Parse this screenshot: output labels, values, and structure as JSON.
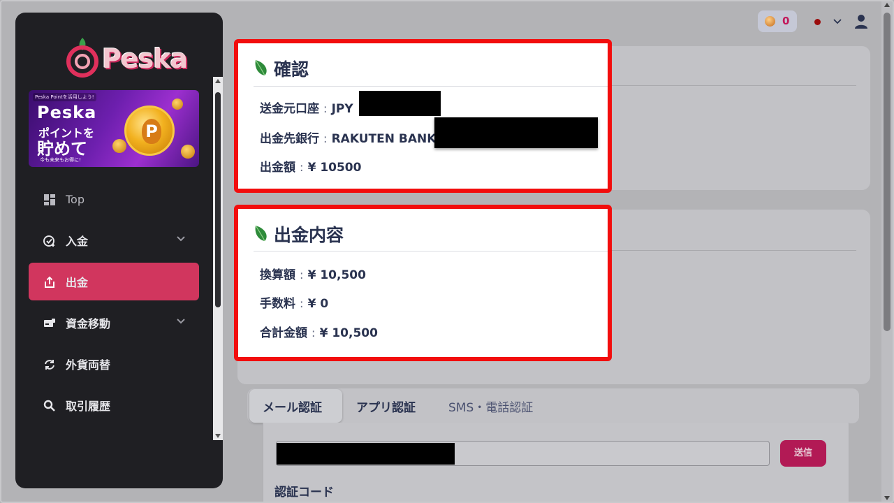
{
  "sidebar": {
    "logo_text": "Peska",
    "banner": {
      "small_text": "Peska Pointを活用しよう!",
      "line1": "Peska",
      "line2": "ポイントを",
      "line3": "貯めて",
      "line4": "今も未来もお得に!",
      "coin_symbol": "P"
    },
    "items": [
      {
        "label": "Top",
        "icon": "dashboard-icon"
      },
      {
        "label": "入金",
        "icon": "deposit-icon",
        "has_chevron": true
      },
      {
        "label": "出金",
        "icon": "withdraw-icon",
        "active": true
      },
      {
        "label": "資金移動",
        "icon": "transfer-icon",
        "has_chevron": true
      },
      {
        "label": "外貨両替",
        "icon": "exchange-icon"
      },
      {
        "label": "取引履歴",
        "icon": "search-icon"
      }
    ]
  },
  "topbar": {
    "points_value": "0",
    "colors": {
      "points": "#c2185b",
      "flag": "#9b0c0c"
    }
  },
  "confirm": {
    "title": "確認",
    "source_account_label": "送金元口座",
    "source_account_value": "JPY",
    "bank_label": "出金先銀行",
    "bank_value": "RAKUTEN BANK",
    "amount_label": "出金額",
    "amount_value": "¥ 10500"
  },
  "details": {
    "title": "出金内容",
    "converted_label": "換算額",
    "converted_value": "¥ 10,500",
    "fee_label": "手数料",
    "fee_value": "¥ 0",
    "total_label": "合計金額",
    "total_value": "¥ 10,500"
  },
  "auth": {
    "tabs": [
      {
        "label": "メール認証",
        "active": true
      },
      {
        "label": "アプリ認証"
      },
      {
        "label": "SMS・電話認証"
      }
    ],
    "send_button": "送信",
    "code_label": "認証コード"
  },
  "sep": ":",
  "colors": {
    "highlight_border": "#f20d0d",
    "active_nav": "#d1365e",
    "send_button": "#b21a55",
    "text_primary": "#2a3350"
  }
}
